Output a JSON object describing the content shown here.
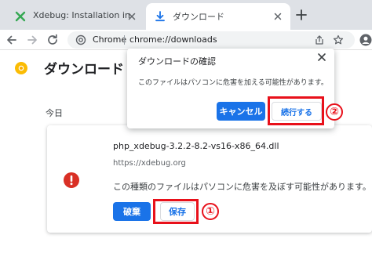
{
  "tabs": [
    {
      "title": "Xdebug: Installation instructions",
      "favicon": "xdebug-x-icon",
      "favicon_color": "#35a853"
    },
    {
      "title": "ダウンロード",
      "favicon": "download-icon",
      "favicon_color": "#1a73e8"
    }
  ],
  "toolbar": {
    "omnibox": {
      "chip_label": "Chrome",
      "url_text": "chrome://downloads"
    }
  },
  "page": {
    "title": "ダウンロード",
    "date_header": "今日"
  },
  "download": {
    "file_name": "php_xdebug-3.2.2-8.2-vs16-x86_64.dll",
    "source_url": "https://xdebug.org",
    "warning_text": "この種類のファイルはパソコンに危害を及ぼす可能性があります。",
    "discard_label": "破棄",
    "keep_label": "保存"
  },
  "dialog": {
    "title": "ダウンロードの確認",
    "message": "このファイルはパソコンに危害を加える可能性があります。",
    "cancel_label": "キャンセル",
    "continue_label": "続行する"
  },
  "annotations": {
    "marker_1": "①",
    "marker_2": "②",
    "highlight_color": "#e8101a"
  },
  "colors": {
    "accent": "#1a73e8",
    "warning": "#d93025",
    "tabstrip": "#dee1e6"
  }
}
